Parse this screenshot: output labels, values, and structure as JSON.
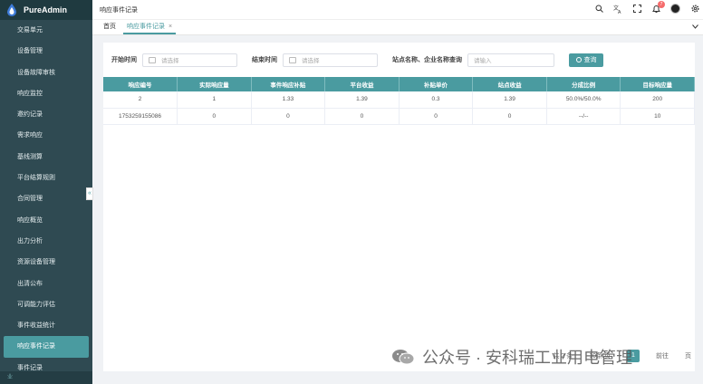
{
  "app": {
    "name": "PureAdmin"
  },
  "sidebar": {
    "items": [
      {
        "label": "交易单元"
      },
      {
        "label": "设备管理"
      },
      {
        "label": "设备故障审核"
      },
      {
        "label": "响应监控"
      },
      {
        "label": "邀约记录"
      },
      {
        "label": "需求响应"
      },
      {
        "label": "基线测算"
      },
      {
        "label": "平台结算规则"
      },
      {
        "label": "合同管理"
      },
      {
        "label": "响应概览"
      },
      {
        "label": "出力分析"
      },
      {
        "label": "资源设备管理"
      },
      {
        "label": "出清公布"
      },
      {
        "label": "可调能力评估"
      },
      {
        "label": "事件收益统计"
      },
      {
        "label": "响应事件记录",
        "active": true
      },
      {
        "label": "事件记录"
      }
    ],
    "collapse": "«",
    "bottom": "业"
  },
  "header": {
    "title": "响应事件记录",
    "notification_count": "7"
  },
  "tabs": [
    {
      "label": "首页"
    },
    {
      "label": "响应事件记录",
      "close": "×"
    }
  ],
  "filters": {
    "start_label": "开始时间",
    "start_placeholder": "请选择",
    "end_label": "结束时间",
    "end_placeholder": "请选择",
    "search_label": "站点名称、企业名称查询",
    "search_placeholder": "请输入",
    "query_label": "查询"
  },
  "table": {
    "columns": [
      "响应编号",
      "实际响应量",
      "事件响应补贴",
      "平台收益",
      "补贴单价",
      "站点收益",
      "分成比例",
      "目标响应量"
    ],
    "rows": [
      [
        "2",
        "1",
        "1.33",
        "1.39",
        "0.3",
        "1.39",
        "50.0%/50.0%",
        "200"
      ],
      [
        "1753259155086",
        "0",
        "0",
        "0",
        "0",
        "0",
        "--/--",
        "10"
      ]
    ]
  },
  "pager": {
    "total": "共 2 条",
    "size": "10条/页",
    "page": "1",
    "goto": "前往",
    "page_unit": "页"
  },
  "watermark": {
    "text": "公众号 · 安科瑞工业用电管理"
  },
  "colors": {
    "accent": "#4a9ba0",
    "sidebar": "#2f4a52"
  }
}
